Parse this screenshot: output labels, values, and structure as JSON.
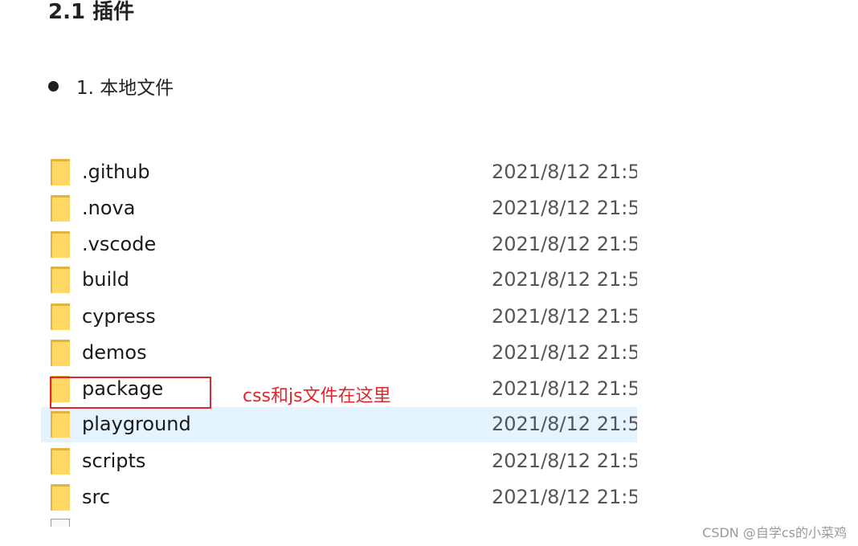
{
  "heading": "2.1 插件",
  "bullet": {
    "text": "1. 本地文件"
  },
  "files": [
    {
      "name": ".github",
      "date": "2021/8/12 21:5"
    },
    {
      "name": ".nova",
      "date": "2021/8/12 21:5"
    },
    {
      "name": ".vscode",
      "date": "2021/8/12 21:5"
    },
    {
      "name": "build",
      "date": "2021/8/12 21:5"
    },
    {
      "name": "cypress",
      "date": "2021/8/12 21:5"
    },
    {
      "name": "demos",
      "date": "2021/8/12 21:5"
    },
    {
      "name": "package",
      "date": "2021/8/12 21:5"
    },
    {
      "name": "playground",
      "date": "2021/8/12 21:5"
    },
    {
      "name": "scripts",
      "date": "2021/8/12 21:5"
    },
    {
      "name": "src",
      "date": "2021/8/12 21:5"
    }
  ],
  "annotation": {
    "text": "css和js文件在这里",
    "color": "#e0262c"
  },
  "watermark": "CSDN @自学cs的小菜鸡",
  "colors": {
    "hover_row": "#e5f3ff",
    "folder": "#ffd866"
  }
}
